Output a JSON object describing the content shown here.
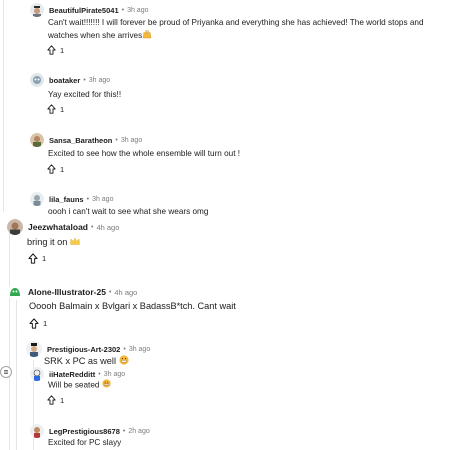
{
  "comments": [
    {
      "username": "BeautifulPirate5041",
      "time": "3h ago",
      "separator": "•",
      "text": "Can't wait!!!!!!! I will forever be proud of Priyanka and everything she has achieved! The world stops and watches when she arrives",
      "emoji": "raised-hands",
      "votes": "1"
    },
    {
      "username": "boataker",
      "time": "3h ago",
      "separator": "•",
      "text": "Yay excited for this!!",
      "votes": "1"
    },
    {
      "username": "Sansa_Baratheon",
      "time": "3h ago",
      "separator": "•",
      "text": "Excited to see how the whole ensemble will turn out !",
      "votes": "1"
    },
    {
      "username": "lila_fauns",
      "time": "3h ago",
      "separator": "•",
      "text": "oooh i can't wait to see what she wears omg",
      "votes": "1"
    },
    {
      "username": "Jeezwhataload",
      "time": "4h ago",
      "separator": "•",
      "text": "bring it on",
      "emoji": "crown",
      "votes": "1"
    },
    {
      "username": "Alone-Illustrator-25",
      "time": "4h ago",
      "separator": "•",
      "text": "Ooooh Balmain x Bvlgari x BadassB*tch. Cant wait",
      "votes": "1"
    },
    {
      "username": "Prestigious-Art-2302",
      "time": "3h ago",
      "separator": "•",
      "text": "SRK x PC as well",
      "emoji": "grin"
    },
    {
      "username": "iiHateRedditt",
      "time": "3h ago",
      "separator": "•",
      "text": "Will be seated",
      "emoji": "grimace",
      "votes": "1"
    },
    {
      "username": "LegPrestigious8678",
      "time": "2h ago",
      "separator": "•",
      "text": "Excited for PC slayy"
    }
  ],
  "icons": {
    "upvote": "upvote-arrow-icon",
    "collapse": "collapse-thread-icon"
  },
  "colors": {
    "thread_line": "#e3e5e8",
    "meta_text": "#7c7c7c",
    "text": "#1c1c1c"
  }
}
